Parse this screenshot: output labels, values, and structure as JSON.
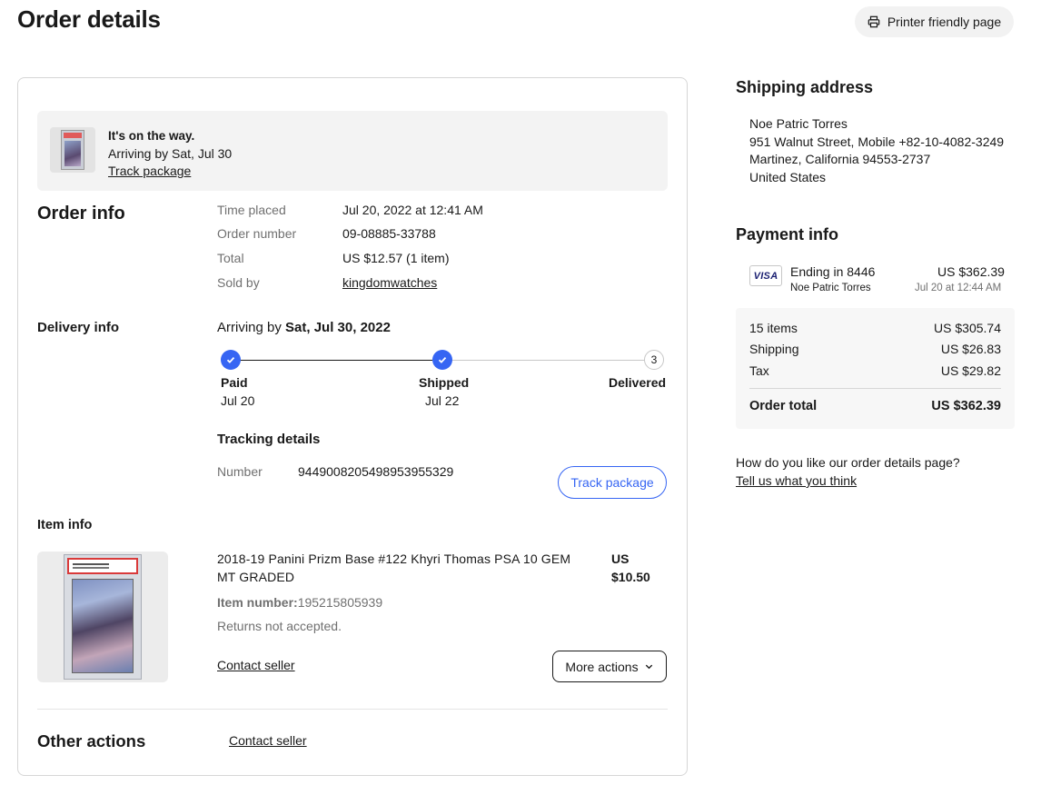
{
  "header": {
    "title": "Order details",
    "print_label": "Printer friendly page"
  },
  "status": {
    "heading": "It's on the way.",
    "arriving": "Arriving by Sat, Jul 30",
    "track_link": "Track package"
  },
  "order_info": {
    "title": "Order info",
    "rows": [
      {
        "label": "Time placed",
        "value": "Jul 20, 2022 at 12:41 AM"
      },
      {
        "label": "Order number",
        "value": "09-08885-33788"
      },
      {
        "label": "Total",
        "value": "US $12.57 (1 item)"
      },
      {
        "label": "Sold by",
        "value": "kingdomwatches"
      }
    ]
  },
  "delivery": {
    "title": "Delivery info",
    "arriving_prefix": "Arriving by ",
    "arriving_date": "Sat, Jul 30, 2022",
    "steps": [
      {
        "label": "Paid",
        "date": "Jul 20",
        "done": true
      },
      {
        "label": "Shipped",
        "date": "Jul 22",
        "done": true
      },
      {
        "label": "Delivered",
        "date": "",
        "number": "3",
        "done": false
      }
    ],
    "tracking_title": "Tracking details",
    "tracking_label": "Number",
    "tracking_number": "9449008205498953955329",
    "track_button": "Track package"
  },
  "item": {
    "section_title": "Item info",
    "title": "2018-19 Panini Prizm Base #122 Khyri Thomas PSA 10 GEM MT GRADED",
    "price": "US $10.50",
    "item_number_label": "Item number:",
    "item_number": "195215805939",
    "returns": "Returns not accepted.",
    "contact_link": "Contact seller",
    "more_actions": "More actions"
  },
  "other_actions": {
    "title": "Other actions",
    "contact_link": "Contact seller"
  },
  "shipping": {
    "title": "Shipping address",
    "lines": [
      "Noe Patric Torres",
      "951 Walnut Street, Mobile +82-10-4082-3249",
      "Martinez, California 94553-2737",
      "United States"
    ]
  },
  "payment": {
    "title": "Payment info",
    "card_brand": "VISA",
    "ending": "Ending in 8446",
    "holder": "Noe Patric Torres",
    "amount": "US $362.39",
    "date": "Jul 20 at 12:44 AM",
    "summary": [
      {
        "label": "15 items",
        "value": "US $305.74"
      },
      {
        "label": "Shipping",
        "value": "US $26.83"
      },
      {
        "label": "Tax",
        "value": "US $29.82"
      }
    ],
    "total_label": "Order total",
    "total_value": "US $362.39"
  },
  "feedback": {
    "question": "How do you like our order details page?",
    "link": "Tell us what you think"
  },
  "colors": {
    "accent": "#3665f3",
    "text": "#191919",
    "muted": "#707070"
  }
}
